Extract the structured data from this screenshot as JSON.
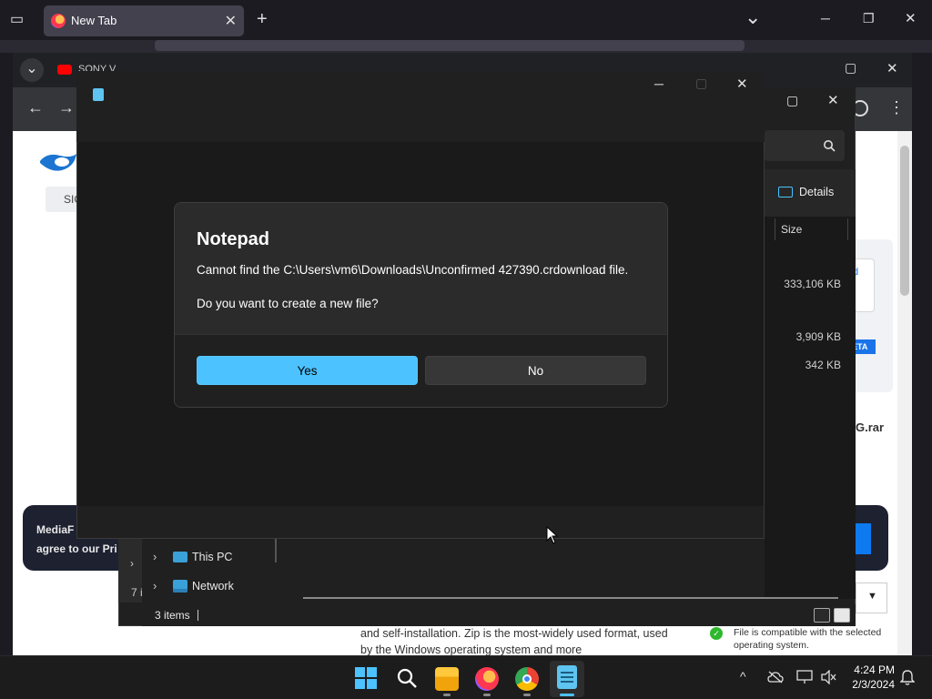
{
  "firefox": {
    "tab_title": "New Tab",
    "tab_close": "✕",
    "new_tab": "+",
    "tabs_list": "⌄",
    "minimize": "─",
    "restore": "❐",
    "close": "✕"
  },
  "chrome": {
    "tab_text": "SONY V",
    "dropdown": "⌄",
    "back": "←",
    "forward": "→",
    "menu": "⋮",
    "restore": "▢",
    "close": "✕"
  },
  "mediafire": {
    "signin": "SIG",
    "cookie_line1": "MediaF",
    "cookie_line2": "agree to our Pri",
    "download_btn": "d",
    "beta": "ETA",
    "filename_fragment": "G.rar",
    "select_arrow": "▼",
    "description": "and self-installation. Zip is the most-widely used format, used by the Windows operating system and more",
    "compat": "File is compatible with the selected operating system.",
    "compat_check": "✓"
  },
  "explorer": {
    "details_label": "Details",
    "size_header": "Size",
    "sizes": [
      "333,106 KB",
      "3,909 KB",
      "342 KB"
    ],
    "nav_items": [
      "This PC",
      "Network"
    ],
    "left_count": "7 i",
    "status": "3 items",
    "restore": "▢",
    "close": "✕"
  },
  "notepad": {
    "minimize": "─",
    "maximize": "▢",
    "close": "✕"
  },
  "dialog": {
    "title": "Notepad",
    "message": "Cannot find the C:\\Users\\vm6\\Downloads\\Unconfirmed 427390.crdownload file.",
    "question": "Do you want to create a new file?",
    "yes": "Yes",
    "no": "No"
  },
  "taskbar": {
    "time": "4:24 PM",
    "date": "2/3/2024",
    "tray_chevron": "^"
  },
  "colors": {
    "accent": "#4cc2ff",
    "dialog_bg": "#2b2b2b"
  }
}
